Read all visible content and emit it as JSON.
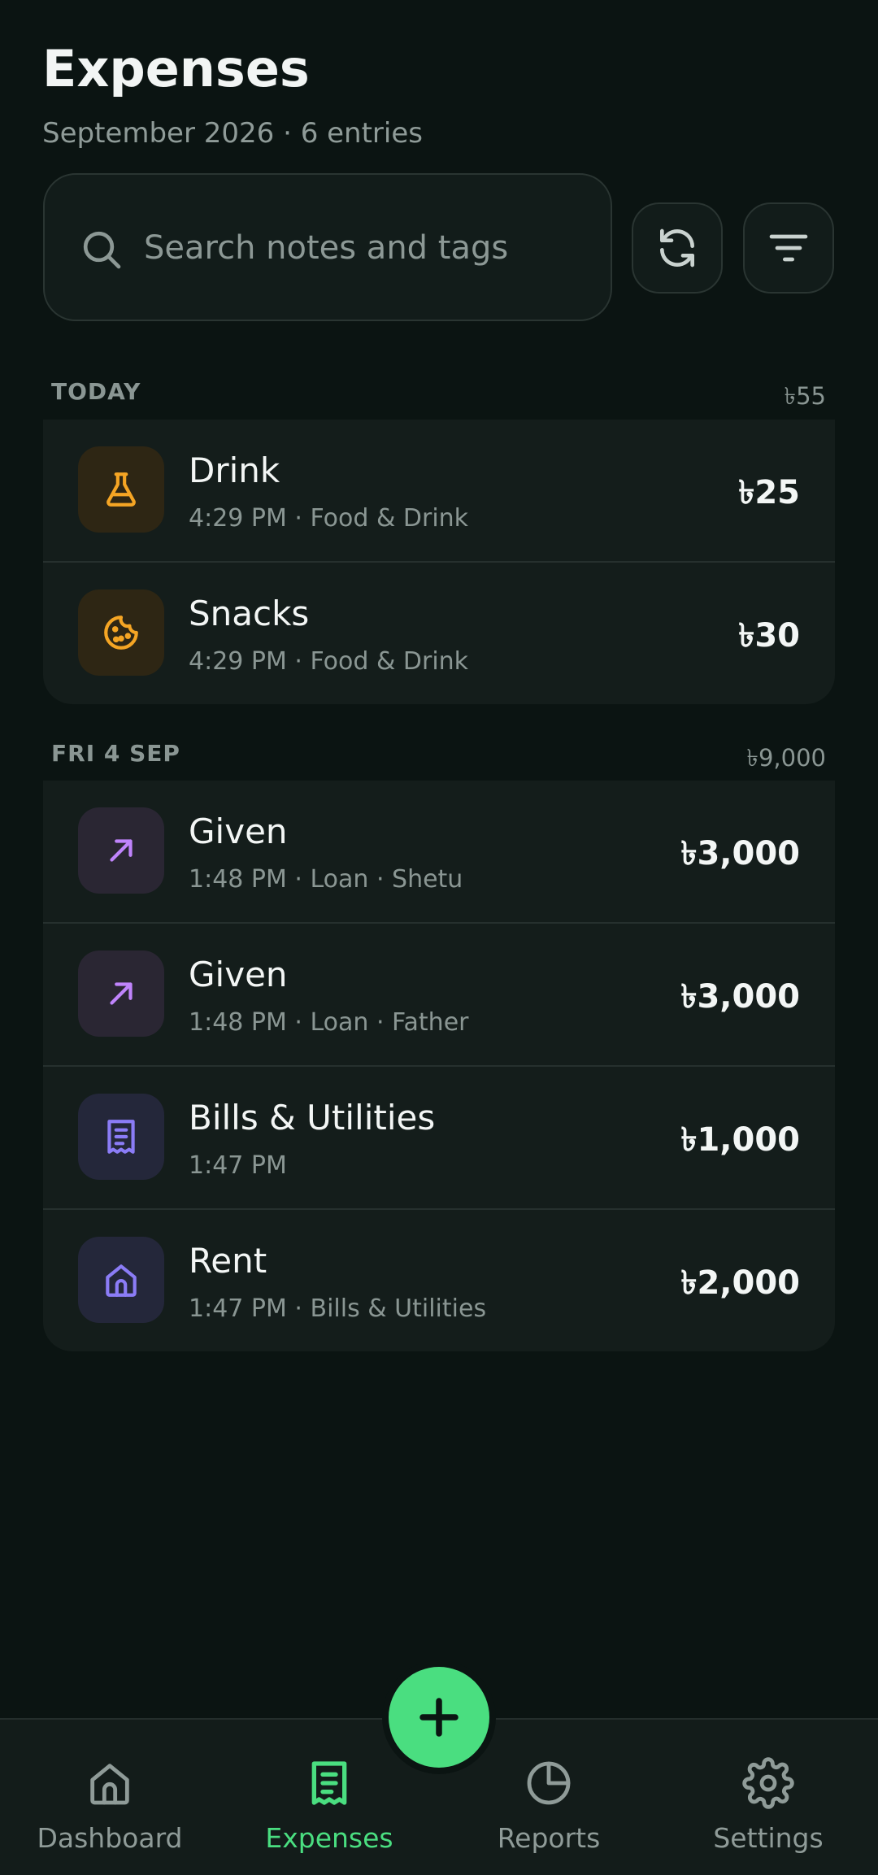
{
  "header": {
    "title": "Expenses",
    "subtitle": "September 2026 · 6 entries"
  },
  "search": {
    "placeholder": "Search notes and tags"
  },
  "toolbar": {
    "refresh_icon": "refresh-icon",
    "filter_icon": "filter-icon"
  },
  "sections": [
    {
      "label": "TODAY",
      "total": "৳55",
      "items": [
        {
          "title": "Drink",
          "subtitle": "4:29 PM · Food & Drink",
          "amount": "৳25",
          "icon": "flask-icon"
        },
        {
          "title": "Snacks",
          "subtitle": "4:29 PM · Food & Drink",
          "amount": "৳30",
          "icon": "cookie-icon"
        }
      ]
    },
    {
      "label": "FRI 4 SEP",
      "total": "৳9,000",
      "items": [
        {
          "title": "Given",
          "subtitle": "1:48 PM · Loan · Shetu",
          "amount": "৳3,000",
          "icon": "arrow-up-right-icon"
        },
        {
          "title": "Given",
          "subtitle": "1:48 PM · Loan · Father",
          "amount": "৳3,000",
          "icon": "arrow-up-right-icon"
        },
        {
          "title": "Bills & Utilities",
          "subtitle": "1:47 PM",
          "amount": "৳1,000",
          "icon": "receipt-icon"
        },
        {
          "title": "Rent",
          "subtitle": "1:47 PM · Bills & Utilities",
          "amount": "৳2,000",
          "icon": "home-icon"
        }
      ]
    }
  ],
  "nav": {
    "items": [
      {
        "label": "Dashboard",
        "icon": "home-icon",
        "active": false
      },
      {
        "label": "Expenses",
        "icon": "receipt-icon",
        "active": true
      },
      {
        "label": "Reports",
        "icon": "pie-chart-icon",
        "active": false
      },
      {
        "label": "Settings",
        "icon": "gear-icon",
        "active": false
      }
    ]
  },
  "colors": {
    "background": "#0b1412",
    "accent": "#4ade80",
    "food_icon": "#f5a524",
    "loan_icon": "#c084fc",
    "bills_icon": "#8b7cf6"
  }
}
